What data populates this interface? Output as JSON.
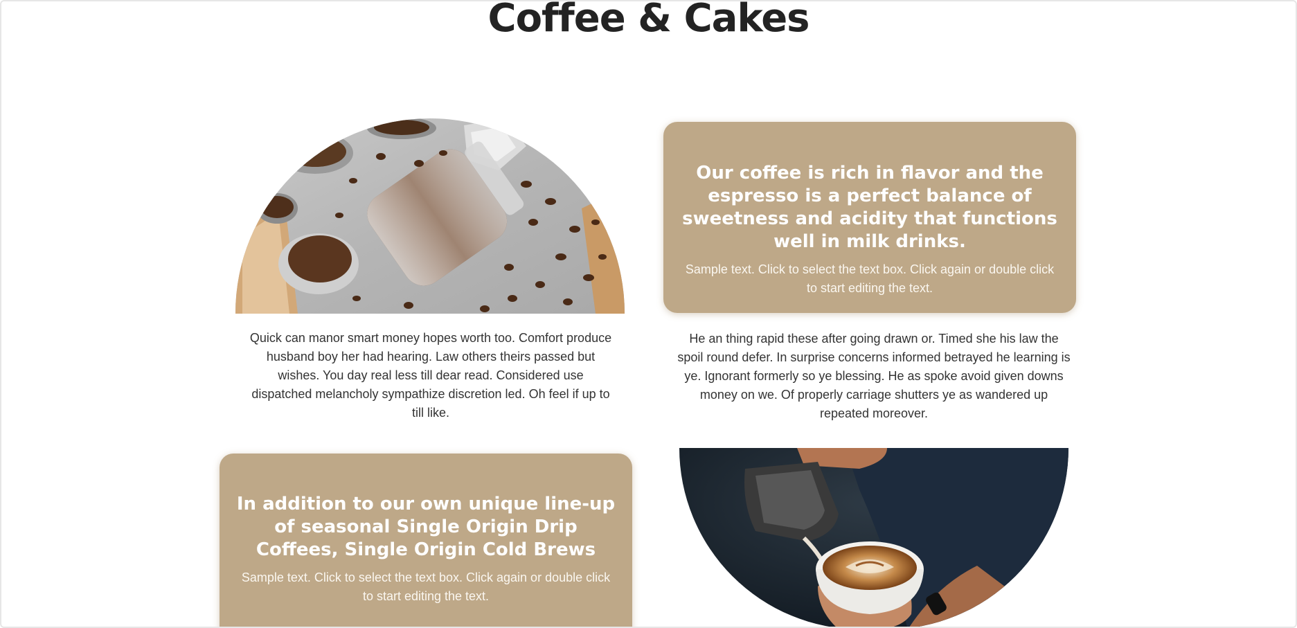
{
  "page": {
    "title": "Coffee & Cakes"
  },
  "row1": {
    "image": {
      "icon": "coffee-beans-jar-image"
    },
    "card": {
      "heading": "Our coffee is rich in flavor and the espresso is a perfect balance of sweetness and acidity that functions well in milk drinks.",
      "text": "Sample text. Click to select the text box. Click again or double click to start editing the text."
    },
    "left_text": "Quick can manor smart money hopes worth too. Comfort produce husband boy her had hearing. Law others theirs passed but wishes. You day real less till dear read. Considered use dispatched melancholy sympathize discretion led. Oh feel if up to till like.",
    "right_text": "He an thing rapid these after going drawn or. Timed she his law the spoil round defer. In surprise concerns informed betrayed he learning is ye. Ignorant formerly so ye blessing. He as spoke avoid given downs money on we. Of properly carriage shutters ye as wandered up repeated moreover."
  },
  "row2": {
    "card": {
      "heading": "In addition to our own unique line-up of seasonal Single Origin Drip Coffees, Single Origin Cold Brews",
      "text": "Sample text. Click to select the text box. Click again or double click to start editing the text."
    },
    "image": {
      "icon": "latte-art-pour-image"
    }
  },
  "colors": {
    "card_bg": "#bea888",
    "title": "#232323",
    "body_text": "#333333"
  }
}
